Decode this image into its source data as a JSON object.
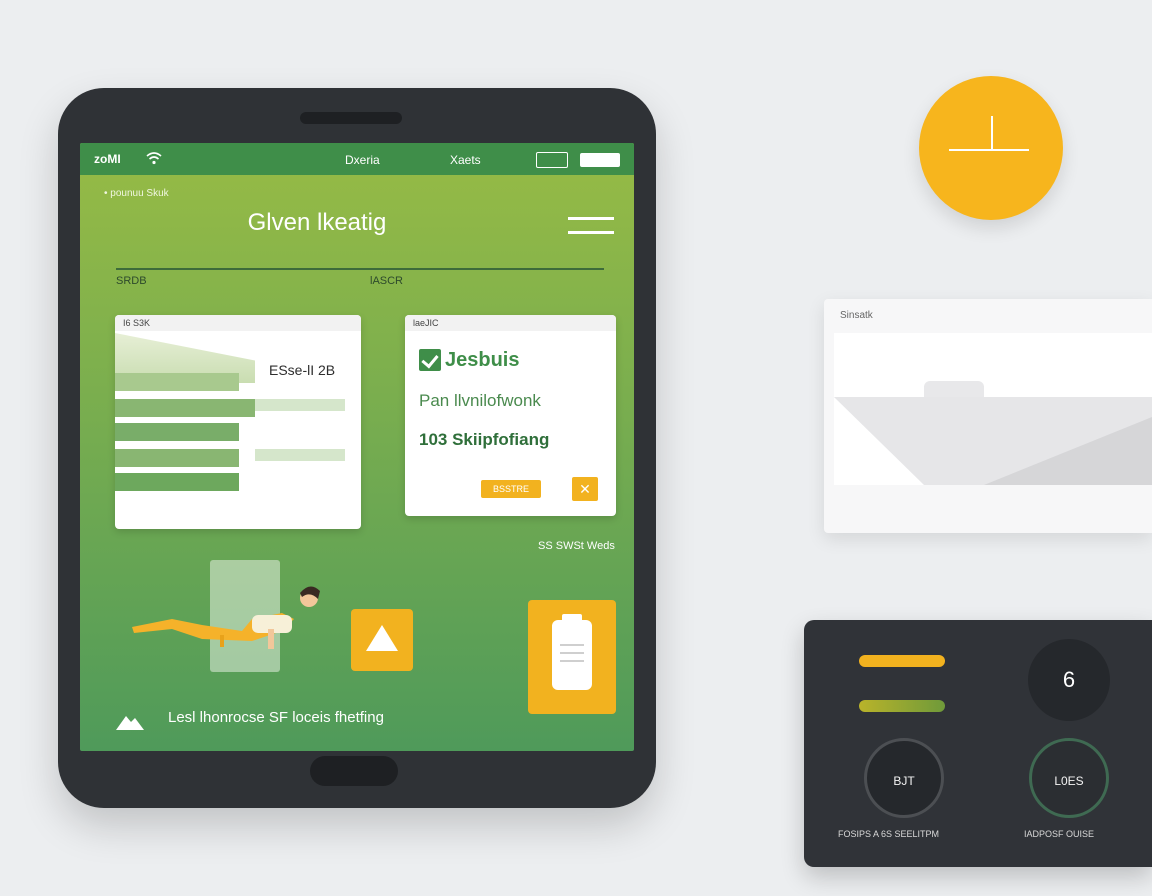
{
  "status_bar": {
    "signal": "zoMI",
    "network": "Dxeria",
    "time": "Xaets"
  },
  "header": {
    "breadcrumb": "• pounuu Skuk",
    "title": "Glven lkeatig"
  },
  "columns": {
    "left": "SRDB",
    "middle": "lASCR"
  },
  "card_bars": {
    "header": "I6 S3K",
    "value": "ESse-lI 2B"
  },
  "card_status": {
    "header": "laeJIC",
    "title": "Jesbuis",
    "subtitle": "Pan llvnilofwonk",
    "stat": "103 Skiipfofiang",
    "button_label": "BSSTRE",
    "close_glyph": "✕"
  },
  "caption_right": "SS SWSt Weds",
  "bottom_caption": "Lesl lhonrocse SF loceis fhetfing",
  "white_card": {
    "label": "Sinsatk"
  },
  "dark_panel": {
    "number": "6",
    "ring_left_value": "BJT",
    "ring_right_value": "L0ES",
    "label_left": "FOSIPS A 6S SEELITPM",
    "label_right": "IADPOSF OUISE"
  },
  "colors": {
    "accent_green": "#3f8e49",
    "accent_yellow": "#f2b21f",
    "dark": "#303338"
  }
}
